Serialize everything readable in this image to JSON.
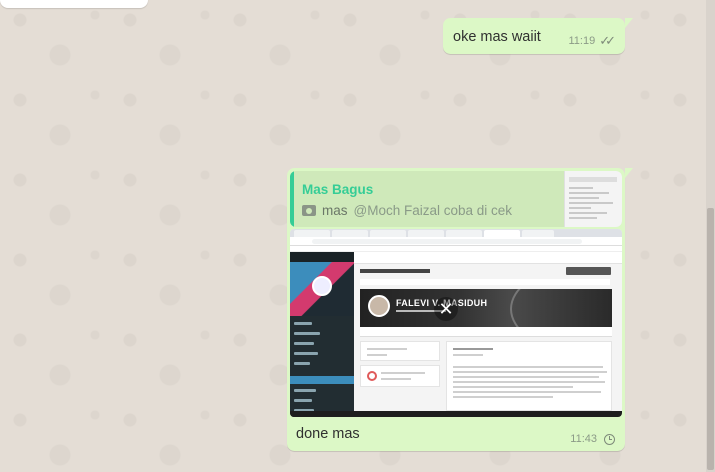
{
  "colors": {
    "chat_background": "#e5ddd5",
    "outgoing_bubble": "#dcf8c6",
    "quote_author": "#35cd96",
    "meta_text": "#8b9a87"
  },
  "messages": [
    {
      "direction": "outgoing",
      "text": "oke mas waiit",
      "time": "11:19",
      "status_icon": "double-check-icon"
    },
    {
      "direction": "outgoing",
      "quoted": {
        "author": "Mas Bagus",
        "media_icon": "camera-icon",
        "text_prefix": "mas ",
        "mention": "@Moch Faizal coba di cek"
      },
      "attachment": {
        "type": "image",
        "profile_name": "FALEVI V. MASIDUH"
      },
      "caption": "done mas",
      "time": "11:43",
      "status_icon": "clock-icon"
    }
  ]
}
